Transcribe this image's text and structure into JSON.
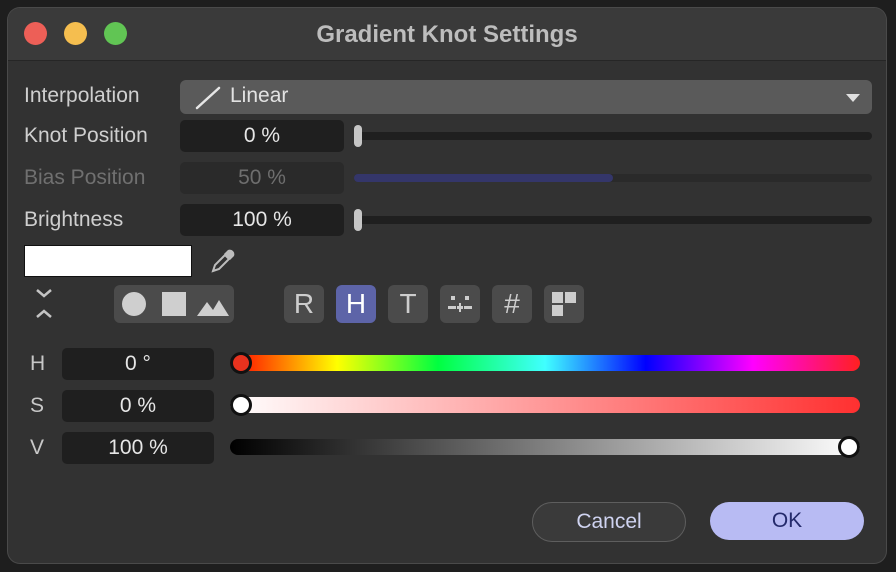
{
  "window": {
    "title": "Gradient Knot Settings"
  },
  "interpolation": {
    "label": "Interpolation",
    "value": "Linear",
    "icon": "linear-curve-icon"
  },
  "knot_position": {
    "label": "Knot Position",
    "value": "0 %",
    "slider": 0.0
  },
  "bias_position": {
    "label": "Bias Position",
    "value": "50 %",
    "slider": 0.5,
    "disabled": true,
    "accent": "#34366a"
  },
  "brightness": {
    "label": "Brightness",
    "value": "100 %",
    "slider": 0.0
  },
  "color": {
    "swatch": "#ffffff",
    "eyedropper_icon": "eyedropper-icon"
  },
  "modes": {
    "collapse_icon": "collapse-expand-icon",
    "shapes": [
      "circle-icon",
      "square-icon",
      "mountains-icon"
    ],
    "buttons": [
      {
        "label": "R",
        "active": false
      },
      {
        "label": "H",
        "active": true
      },
      {
        "label": "T",
        "active": false
      },
      {
        "label": "",
        "icon": "mixer-icon",
        "active": false
      },
      {
        "label": "#",
        "active": false
      },
      {
        "label": "",
        "icon": "swatch-grid-icon",
        "active": false
      }
    ],
    "active_color": "#5d64a8"
  },
  "hsv": {
    "h": {
      "label": "H",
      "value": "0 °",
      "fraction": 0.0,
      "knob_color": "#e8321e"
    },
    "s": {
      "label": "S",
      "value": "0 %",
      "fraction": 0.0,
      "knob_color": "#ffffff"
    },
    "v": {
      "label": "V",
      "value": "100 %",
      "fraction": 1.0,
      "knob_color": "#ffffff"
    }
  },
  "buttons": {
    "cancel": "Cancel",
    "ok": "OK",
    "ok_color": "#b8bbf3"
  }
}
